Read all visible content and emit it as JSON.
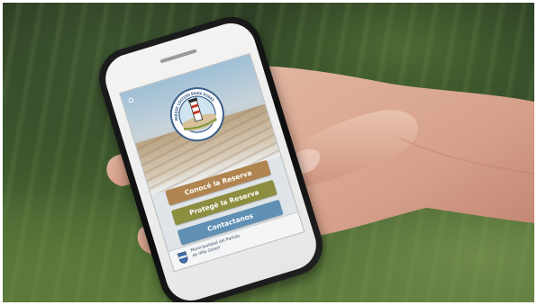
{
  "app": {
    "logo_text": "PARQUE COSTERO BAHÍA DUNAS",
    "menu": [
      {
        "label": "Conocé la Reserva",
        "color": "#b0844f"
      },
      {
        "label": "Protegé la Reserva",
        "color": "#8c8d3f"
      },
      {
        "label": "Contactanos",
        "color": "#5f8fb3"
      }
    ],
    "footer": {
      "line1": "Municipalidad del Partido",
      "line2": "de Villa Gesell"
    }
  },
  "icons": {
    "home": "home-icon",
    "logo": "reserve-logo-icon",
    "crest": "municipal-crest-icon"
  }
}
